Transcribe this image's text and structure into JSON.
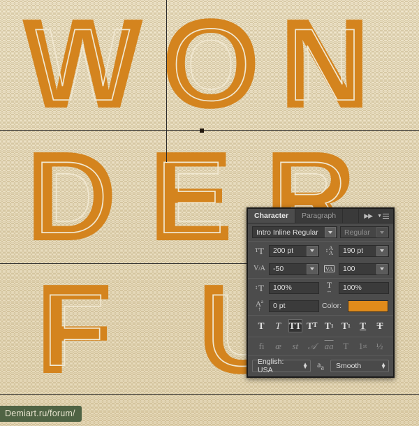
{
  "artwork": {
    "rows": [
      {
        "letters": [
          "W",
          "O",
          "N"
        ]
      },
      {
        "letters": [
          "D",
          "E",
          "R"
        ]
      },
      {
        "letters": [
          "F",
          "U"
        ]
      }
    ]
  },
  "watermark": {
    "text": "Demiart.ru/forum/",
    "bg": "#4f6344"
  },
  "colors": {
    "letter_orange": "#d4841e",
    "inline_cream": "#f0e7d0",
    "swatch_orange": "#e08b1b",
    "panel_bg": "#4c4c4c"
  },
  "panel": {
    "tabs": [
      {
        "label": "Character",
        "active": true
      },
      {
        "label": "Paragraph",
        "active": false
      }
    ],
    "collapse_icon": "double-right-arrow-icon",
    "menu_icon": "panel-menu-icon",
    "font_family": {
      "value": "Intro Inline Regular",
      "icon": "chevron-down-icon"
    },
    "font_style": {
      "value": "Regular",
      "disabled": true,
      "icon": "chevron-down-icon"
    },
    "font_size": {
      "icon": "font-size-icon",
      "value": "200 pt"
    },
    "leading": {
      "icon": "leading-icon",
      "value": "190 pt"
    },
    "kerning": {
      "icon": "kerning-icon",
      "value": "-50"
    },
    "tracking": {
      "icon": "tracking-icon",
      "value": "100"
    },
    "vertical_scale": {
      "icon": "vertical-scale-icon",
      "value": "100%"
    },
    "horizontal_scale": {
      "icon": "horizontal-scale-icon",
      "value": "100%"
    },
    "baseline_shift": {
      "icon": "baseline-shift-icon",
      "value": "0 pt"
    },
    "color": {
      "label": "Color:",
      "value": "#e08b1b"
    },
    "style_buttons": [
      {
        "name": "faux-bold",
        "glyph": "T",
        "active": false
      },
      {
        "name": "faux-italic",
        "glyph": "T",
        "active": false
      },
      {
        "name": "all-caps",
        "glyph": "TT",
        "active": true
      },
      {
        "name": "small-caps",
        "glyph": "TT",
        "active": false
      },
      {
        "name": "superscript",
        "glyph": "T",
        "active": false
      },
      {
        "name": "subscript",
        "glyph": "T",
        "active": false
      },
      {
        "name": "underline",
        "glyph": "T",
        "active": false
      },
      {
        "name": "strikethrough",
        "glyph": "T",
        "active": false
      }
    ],
    "opentype_buttons": [
      {
        "name": "standard-ligatures",
        "glyph": "fi"
      },
      {
        "name": "contextual-alternates",
        "glyph": "œ"
      },
      {
        "name": "discretionary-ligatures",
        "glyph": "st"
      },
      {
        "name": "swash",
        "glyph": "𝒜"
      },
      {
        "name": "oldstyle",
        "glyph": "aa"
      },
      {
        "name": "titling-alternates",
        "glyph": "T"
      },
      {
        "name": "ordinals",
        "glyph": "1st"
      },
      {
        "name": "fractions",
        "glyph": "½"
      }
    ],
    "language": {
      "value": "English: USA"
    },
    "antialias_icon": "anti-alias-icon",
    "antialias": {
      "value": "Smooth"
    }
  }
}
